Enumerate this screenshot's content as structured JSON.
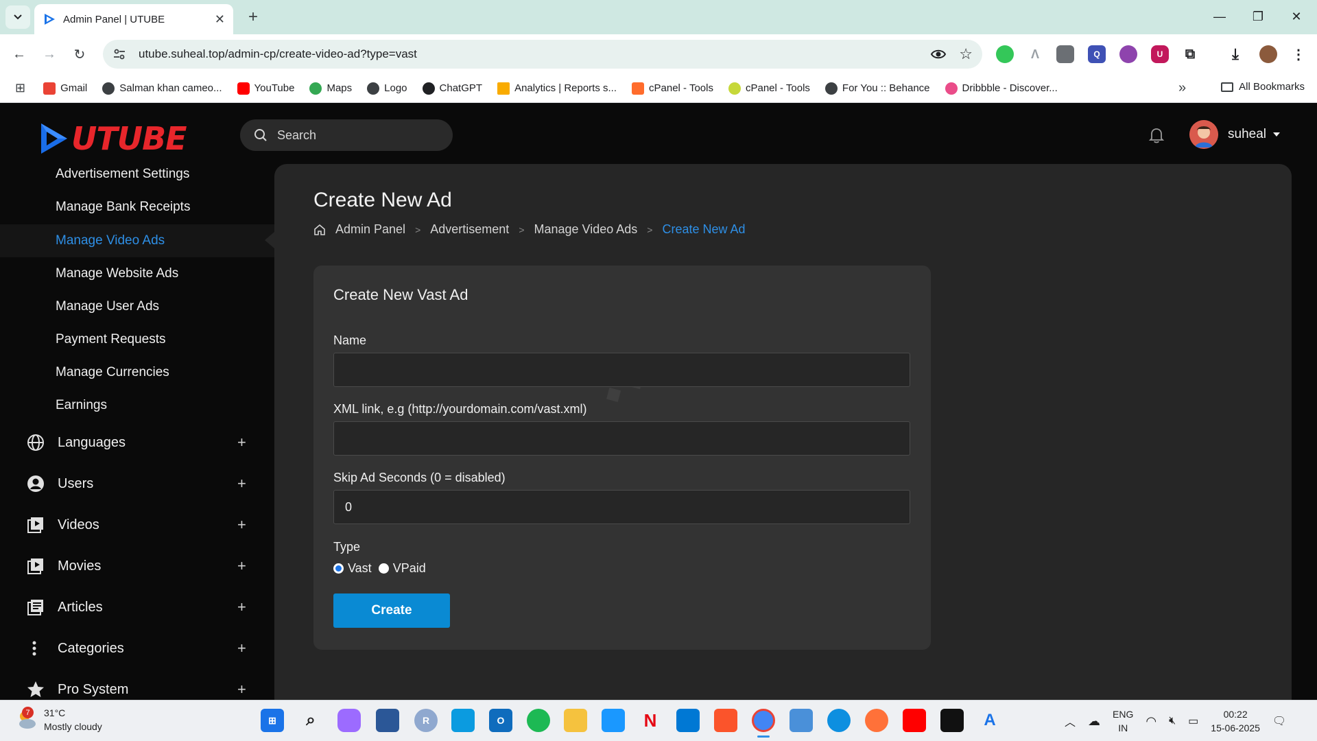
{
  "browser": {
    "tab_title": "Admin Panel | UTUBE",
    "url": "utube.suheal.top/admin-cp/create-video-ad?type=vast",
    "bookmarks": [
      "Gmail",
      "Salman khan cameo...",
      "YouTube",
      "Maps",
      "Logo",
      "ChatGPT",
      "Analytics | Reports s...",
      "cPanel - Tools",
      "cPanel - Tools",
      "For You :: Behance",
      "Dribbble - Discover..."
    ],
    "all_bookmarks": "All Bookmarks",
    "more_bookmarks": "»"
  },
  "app": {
    "logo": "UTUBE",
    "search_placeholder": "Search",
    "user_name": "suheal"
  },
  "sidebar": {
    "sub_items": [
      {
        "label": "Advertisement Settings",
        "active": false
      },
      {
        "label": "Manage Bank Receipts",
        "active": false
      },
      {
        "label": "Manage Video Ads",
        "active": true
      },
      {
        "label": "Manage Website Ads",
        "active": false
      },
      {
        "label": "Manage User Ads",
        "active": false
      },
      {
        "label": "Payment Requests",
        "active": false
      },
      {
        "label": "Manage Currencies",
        "active": false
      },
      {
        "label": "Earnings",
        "active": false
      }
    ],
    "main_items": [
      {
        "label": "Languages",
        "icon": "globe-icon"
      },
      {
        "label": "Users",
        "icon": "user-circle-icon"
      },
      {
        "label": "Videos",
        "icon": "video-library-icon"
      },
      {
        "label": "Movies",
        "icon": "movie-library-icon"
      },
      {
        "label": "Articles",
        "icon": "articles-icon"
      },
      {
        "label": "Categories",
        "icon": "vertical-dots-icon"
      },
      {
        "label": "Pro System",
        "icon": "star-icon"
      }
    ],
    "expand_symbol": "+"
  },
  "page": {
    "title": "Create New Ad",
    "breadcrumb": [
      "Admin Panel",
      "Advertisement",
      "Manage Video Ads",
      "Create New Ad"
    ],
    "breadcrumb_sep": ">"
  },
  "form": {
    "card_title": "Create New Vast Ad",
    "name_label": "Name",
    "name_value": "",
    "xml_label": "XML link, e.g (http://yourdomain.com/vast.xml)",
    "xml_value": "",
    "skip_label": "Skip Ad Seconds (0 = disabled)",
    "skip_value": "0",
    "type_label": "Type",
    "type_options": [
      "Vast",
      "VPaid"
    ],
    "type_selected": "Vast",
    "submit_label": "Create"
  },
  "taskbar": {
    "weather_temp": "31°C",
    "weather_desc": "Mostly cloudy",
    "weather_badge": "7",
    "lang_top": "ENG",
    "lang_bottom": "IN",
    "time": "00:22",
    "date": "15-06-2025"
  },
  "colors": {
    "accent": "#2e8fe6",
    "button": "#0a8ad3",
    "logo_red": "#e8262b"
  }
}
